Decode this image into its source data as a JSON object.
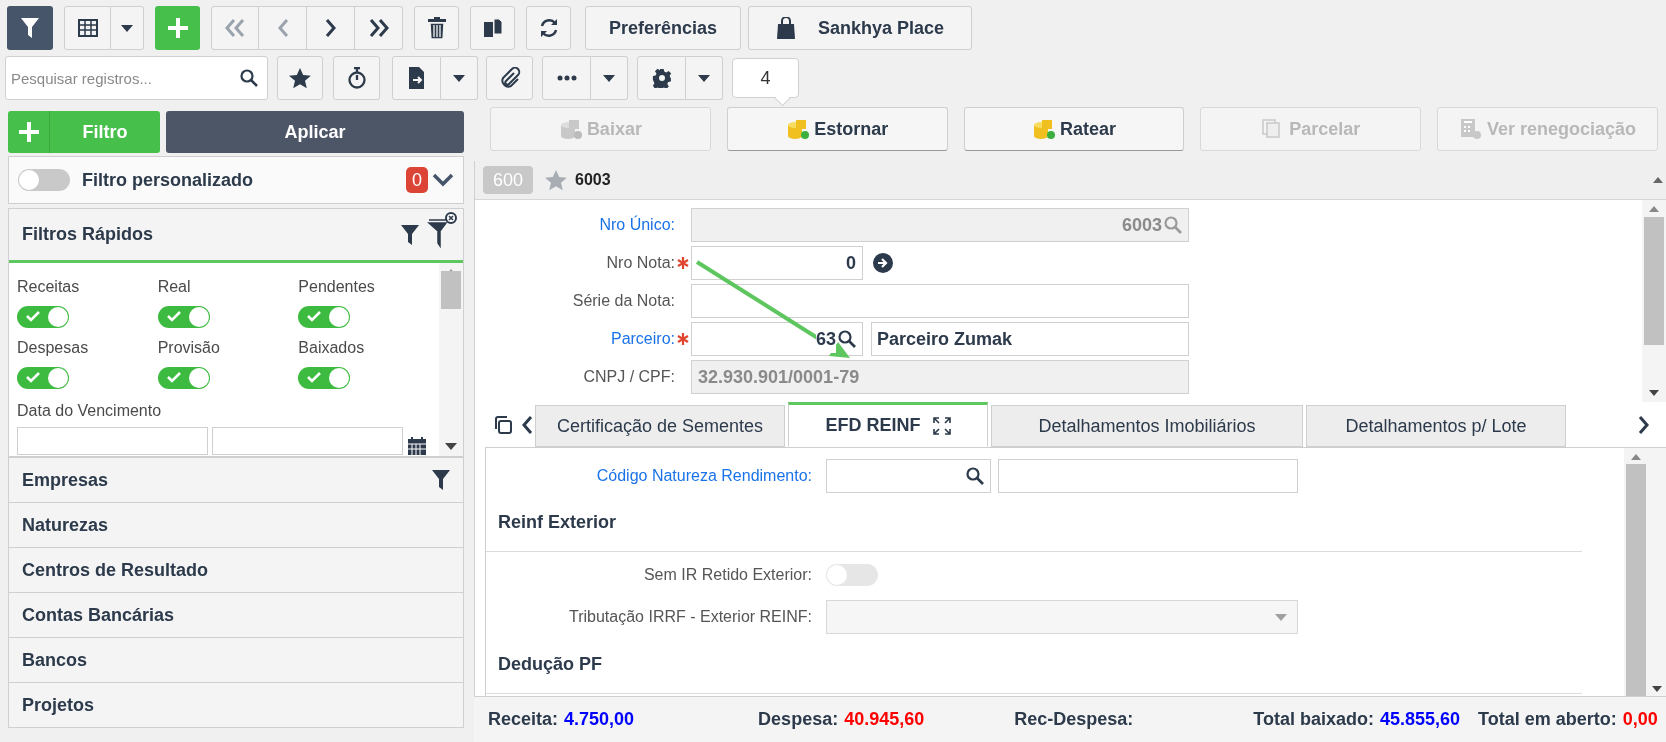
{
  "toolbar": {
    "preferences": "Preferências",
    "place": "Sankhya Place"
  },
  "search": {
    "placeholder": "Pesquisar registros..."
  },
  "badge": "4",
  "filter_panel": {
    "add_label": "Filtro",
    "apply_label": "Aplicar",
    "custom": {
      "label": "Filtro personalizado",
      "on": false,
      "count": "0"
    },
    "quick": {
      "title": "Filtros Rápidos",
      "toggles": [
        {
          "label": "Receitas",
          "on": true
        },
        {
          "label": "Real",
          "on": true
        },
        {
          "label": "Pendentes",
          "on": true
        },
        {
          "label": "Despesas",
          "on": true
        },
        {
          "label": "Provisão",
          "on": true
        },
        {
          "label": "Baixados",
          "on": true
        }
      ],
      "date_label": "Data do Vencimento"
    },
    "sections": [
      {
        "label": "Empresas",
        "filter": true
      },
      {
        "label": "Naturezas",
        "filter": false
      },
      {
        "label": "Centros de Resultado",
        "filter": false
      },
      {
        "label": "Contas Bancárias",
        "filter": false
      },
      {
        "label": "Bancos",
        "filter": false
      },
      {
        "label": "Projetos",
        "filter": false
      }
    ]
  },
  "actions": [
    {
      "label": "Baixar",
      "disabled": true
    },
    {
      "label": "Estornar",
      "disabled": false
    },
    {
      "label": "Ratear",
      "disabled": false
    },
    {
      "label": "Parcelar",
      "disabled": true
    },
    {
      "label": "Ver renegociação",
      "disabled": true
    }
  ],
  "record": {
    "code": "600",
    "number": "6003"
  },
  "form": [
    {
      "label": "Nro Único:",
      "link": true,
      "required": false,
      "kind": "lookup",
      "disabled": true,
      "value": "6003"
    },
    {
      "label": "Nro Nota:",
      "link": false,
      "required": true,
      "kind": "go",
      "disabled": false,
      "value": "0"
    },
    {
      "label": "Série da Nota:",
      "link": false,
      "required": false,
      "kind": "text",
      "disabled": false
    },
    {
      "label": "Parceiro:",
      "link": true,
      "required": true,
      "kind": "lookup_desc",
      "disabled": false,
      "value": "63",
      "description": "Parceiro Zumak"
    },
    {
      "label": "CNPJ / CPF:",
      "link": false,
      "required": false,
      "kind": "text",
      "disabled": true,
      "value": "32.930.901/0001-79"
    }
  ],
  "tabs": [
    {
      "label": "Certificação de Sementes",
      "selected": false
    },
    {
      "label": "EFD REINF",
      "selected": true
    },
    {
      "label": "Detalhamentos Imobiliários",
      "selected": false
    },
    {
      "label": "Detalhamentos p/ Lote",
      "selected": false
    }
  ],
  "tab_content": [
    {
      "kind": "lookup",
      "label": "Código Natureza Rendimento:",
      "link": true
    },
    {
      "kind": "section",
      "label": "Reinf Exterior"
    },
    {
      "kind": "toggle",
      "label": "Sem IR Retido Exterior:",
      "on": false
    },
    {
      "kind": "select",
      "label": "Tributação IRRF - Exterior REINF:"
    },
    {
      "kind": "section",
      "label": "Dedução PF"
    }
  ],
  "totals": [
    {
      "label": "Receita:",
      "value": "4.750,00",
      "color": "#0000ff"
    },
    {
      "label": "Despesa:",
      "value": "40.945,60",
      "color": "#ff0000"
    },
    {
      "label": "Rec-Despesa:"
    },
    {
      "label": "Total baixado:",
      "value": "45.855,60",
      "color": "#0000ff"
    },
    {
      "label": "Total em aberto:",
      "value": "0,00",
      "color": "#ff0000"
    }
  ]
}
